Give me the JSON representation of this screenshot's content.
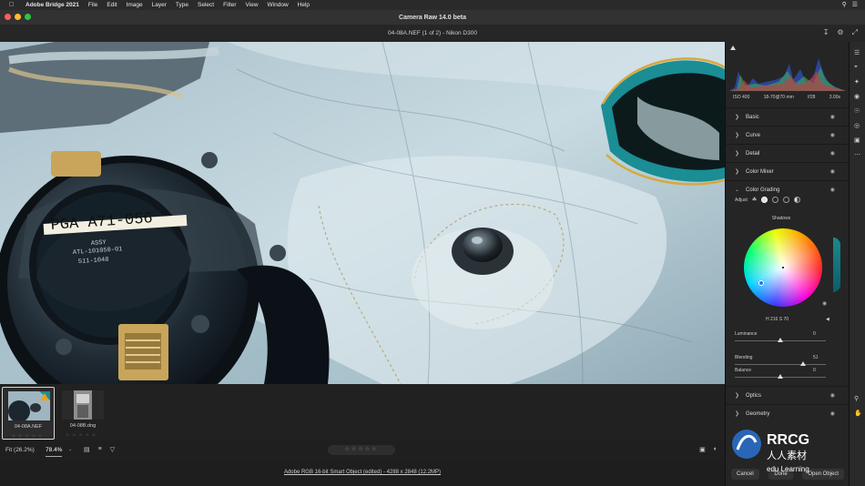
{
  "menubar": {
    "apple": "",
    "app_name": "Adobe Bridge 2021",
    "items": [
      "File",
      "Edit",
      "Image",
      "Layer",
      "Type",
      "Select",
      "Filter",
      "View",
      "Window",
      "Help"
    ]
  },
  "window": {
    "title": "Camera Raw 14.0 beta"
  },
  "file": {
    "label": "04-08A.NEF (1 of 2)  -  Nikon D300"
  },
  "photo": {
    "label_lines": [
      "PGA A71-056",
      "ASSY",
      "ATL-101050-01",
      "511-1048"
    ]
  },
  "filmstrip": {
    "items": [
      {
        "name": "04-08A.NEF",
        "stars": "☆ ☆ ☆ ☆ ☆",
        "selected": true
      },
      {
        "name": "04-08B.dng",
        "stars": "☆ ☆ ☆ ☆ ☆",
        "selected": false
      }
    ]
  },
  "bottombar": {
    "fit": "Fit (26.2%)",
    "zoom": "78.4%",
    "zoom_caret": "⌄",
    "rating": "☆☆☆☆☆"
  },
  "footer": {
    "workflow": "Adobe RGB 16-bit Smart Object (edited) - 4288 x 2848 (12.2MP)"
  },
  "histogram": {
    "exif": [
      "ISO 400",
      "18-70@70 mm",
      "f/28",
      "3.00s"
    ]
  },
  "panel": {
    "sections": [
      {
        "label": "Basic",
        "expanded": false
      },
      {
        "label": "Curve",
        "expanded": false
      },
      {
        "label": "Detail",
        "expanded": false
      },
      {
        "label": "Color Mixer",
        "expanded": false
      },
      {
        "label": "Color Grading",
        "expanded": true
      },
      {
        "label": "Optics",
        "expanded": false
      },
      {
        "label": "Geometry",
        "expanded": false
      }
    ],
    "color_grading": {
      "adjust_label": "Adjust",
      "wheel_label": "Shadows",
      "hue_readout": "H 216  S 70",
      "sliders": [
        {
          "label": "Luminance",
          "value": "0",
          "fraction": 0.5
        },
        {
          "label": "Blending",
          "value": "51",
          "fraction": 0.75
        },
        {
          "label": "Balance",
          "value": "0",
          "fraction": 0.5
        }
      ]
    },
    "footer": {
      "cancel": "Cancel",
      "done": "Done",
      "open": "Open Object"
    }
  },
  "watermark": {
    "brand": "RRCG",
    "sub": "人人素材",
    "corner_text": "edu Learning"
  },
  "colors": {
    "accent_blue": "#3d6fd8",
    "wheel_marker": "#2a2aff"
  },
  "icons": [
    "apple-icon",
    "search-icon",
    "control-center-icon",
    "save-icon",
    "gear-icon",
    "fullscreen-icon",
    "filter-icon",
    "sort-icon",
    "rating-star-icon",
    "eye-icon",
    "crop-icon",
    "healing-icon",
    "mask-icon",
    "redeye-icon",
    "presets-icon",
    "snapshots-icon",
    "more-icon",
    "zoom-icon",
    "hand-icon"
  ]
}
